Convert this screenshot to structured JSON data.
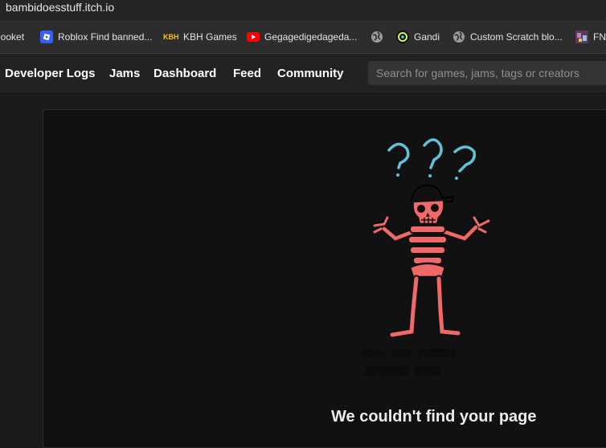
{
  "browser": {
    "url": "bambidoesstuff.itch.io"
  },
  "bookmarks": [
    {
      "label": "looket",
      "icon": "none"
    },
    {
      "label": "Roblox Find banned...",
      "icon": "roblox-icon"
    },
    {
      "label": "KBH Games",
      "icon": "kbh-icon",
      "icon_text": "KBH"
    },
    {
      "label": "Gegagedigedageda...",
      "icon": "youtube-icon"
    },
    {
      "label": "",
      "icon": "globe-icon"
    },
    {
      "label": "Gandi",
      "icon": "gandi-icon"
    },
    {
      "label": "Custom Scratch blo...",
      "icon": "globe-icon"
    },
    {
      "label": "FN",
      "icon": "game-icon"
    }
  ],
  "nav": {
    "items": [
      "Developer Logs",
      "Jams",
      "Dashboard",
      "Feed",
      "Community"
    ],
    "search_placeholder": "Search for games, jams, tags or creators"
  },
  "error": {
    "illustration_line1": "404: NOT FOUND!",
    "illustration_line2": "NOTHING HERE",
    "title": "We couldn't find your page"
  },
  "colors": {
    "accent": "#fa5c5c",
    "question_marks": "#5fc2d9",
    "background": "#1b1b1b",
    "card": "#111111"
  }
}
